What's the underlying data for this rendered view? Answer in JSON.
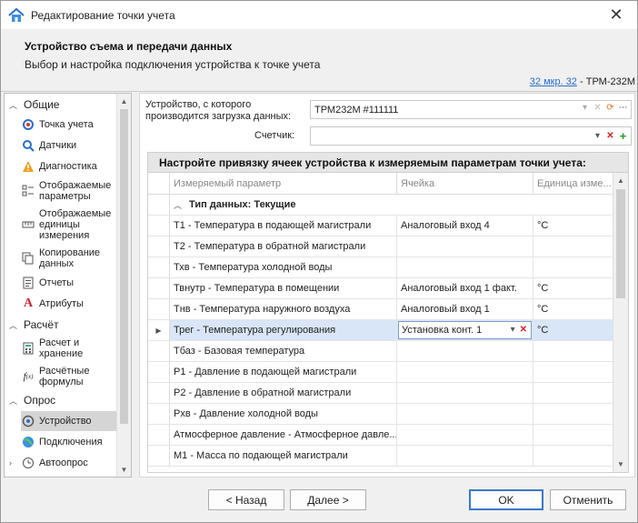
{
  "window": {
    "title": "Редактирование точки учета",
    "close_glyph": "✕"
  },
  "header": {
    "title": "Устройство съема и передачи данных",
    "subtitle": "Выбор и настройка подключения устройства к точке учета",
    "crumb_link": "32 мкр. 32",
    "crumb_sep": " - ",
    "crumb_device": "ТРМ-232М"
  },
  "sidebar": {
    "groups": {
      "general": "Общие",
      "calc": "Расчёт",
      "poll": "Опрос"
    },
    "items": [
      {
        "label": "Точка учета",
        "icon": "location-pin-icon"
      },
      {
        "label": "Датчики",
        "icon": "sensor-icon"
      },
      {
        "label": "Диагностика",
        "icon": "warning-icon"
      },
      {
        "label": "Отображаемые параметры",
        "icon": "checklist-icon"
      },
      {
        "label": "Отображаемые единицы измерения",
        "icon": "ruler-icon"
      },
      {
        "label": "Копирование данных",
        "icon": "copy-icon"
      },
      {
        "label": "Отчеты",
        "icon": "report-icon"
      },
      {
        "label": "Атрибуты",
        "icon": "attribute-icon"
      },
      {
        "label": "Расчет и хранение",
        "icon": "calculator-icon"
      },
      {
        "label": "Расчётные формулы",
        "icon": "formula-icon"
      },
      {
        "label": "Устройство",
        "icon": "device-icon"
      },
      {
        "label": "Подключения",
        "icon": "globe-icon"
      },
      {
        "label": "Автоопрос",
        "icon": "clock-icon"
      }
    ]
  },
  "device": {
    "label": "Устройство, с которого производится загрузка данных:",
    "value": "ТРМ232М #111111"
  },
  "counter": {
    "label": "Счетчик:",
    "value": ""
  },
  "grid": {
    "caption": "Настройте привязку ячеек устройства к измеряемым параметрам точки учета:",
    "columns": [
      "Измеряемый параметр",
      "Ячейка",
      "Единица изме..."
    ],
    "group_label": "Тип данных: Текущие",
    "rows": [
      {
        "param": "Т1 - Температура в подающей магистрали",
        "cell": "Аналоговый вход 4",
        "unit": "°С"
      },
      {
        "param": "Т2 - Температура в обратной магистрали",
        "cell": "",
        "unit": ""
      },
      {
        "param": "Тхв - Температура холодной воды",
        "cell": "",
        "unit": ""
      },
      {
        "param": "Твнутр - Температура в помещении",
        "cell": "Аналоговый вход 1 факт.",
        "unit": "°С"
      },
      {
        "param": "Тнв - Температура наружного воздуха",
        "cell": "Аналоговый вход 1",
        "unit": "°С"
      },
      {
        "param": "Трег - Температура регулирования",
        "cell": "Установка конт. 1",
        "unit": "°С"
      },
      {
        "param": "Тбаз - Базовая температура",
        "cell": "",
        "unit": ""
      },
      {
        "param": "P1 - Давление в подающей магистрали",
        "cell": "",
        "unit": ""
      },
      {
        "param": "P2 - Давление в обратной магистрали",
        "cell": "",
        "unit": ""
      },
      {
        "param": "Pхв - Давление холодной воды",
        "cell": "",
        "unit": ""
      },
      {
        "param": "Атмосферное давление - Атмосферное давле...",
        "cell": "",
        "unit": ""
      },
      {
        "param": "M1 - Масса по подающей магистрали",
        "cell": "",
        "unit": ""
      }
    ]
  },
  "footer": {
    "back": "< Назад",
    "next": "Далее >",
    "ok": "OK",
    "cancel": "Отменить"
  },
  "colors": {
    "accent": "#2a6fc9",
    "selection": "#d9e6f8",
    "delete": "#d02020",
    "add": "#2a9a2a"
  }
}
